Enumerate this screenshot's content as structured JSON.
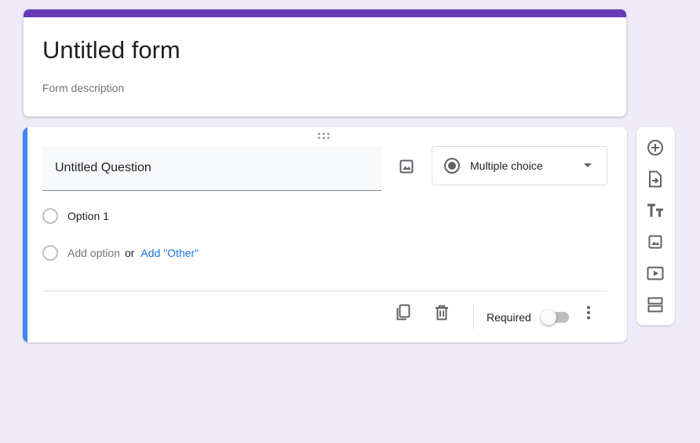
{
  "form": {
    "title": "Untitled form",
    "description_placeholder": "Form description"
  },
  "question": {
    "title": "Untitled Question",
    "type_label": "Multiple choice",
    "options": [
      "Option 1"
    ],
    "add_option_label": "Add option",
    "or_label": "or",
    "add_other_label": "Add \"Other\"",
    "required_label": "Required",
    "required": false
  },
  "toolbar": {
    "tools": [
      "add-question-icon",
      "import-questions-icon",
      "add-title-icon",
      "add-image-icon",
      "add-video-icon",
      "add-section-icon"
    ]
  },
  "colors": {
    "accent": "#673ab7",
    "question_bar": "#4285f4",
    "link": "#1a73e8",
    "background": "#f0ebf8"
  }
}
